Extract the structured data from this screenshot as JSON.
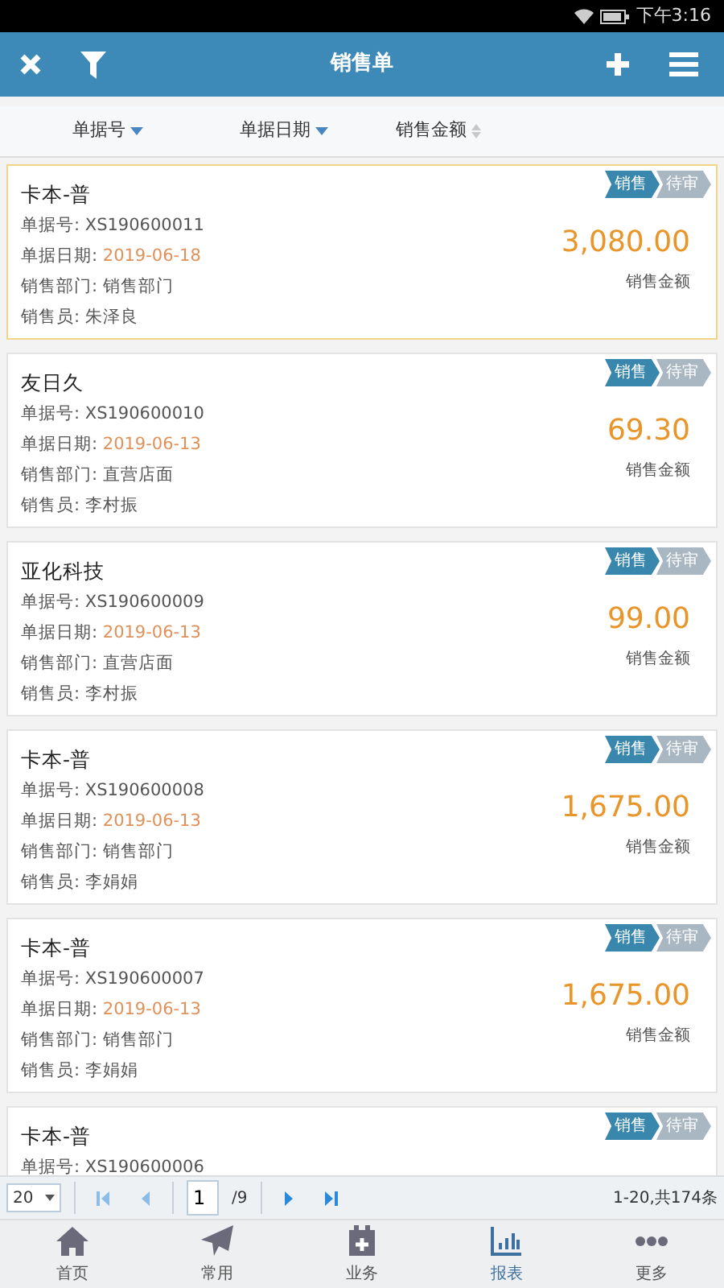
{
  "status_bar": {
    "time": "下午3:16"
  },
  "header": {
    "title": "销售单"
  },
  "sort_bar": [
    {
      "label": "单据号",
      "sorted": true
    },
    {
      "label": "单据日期",
      "sorted": true
    },
    {
      "label": "销售金额",
      "sorted": false
    }
  ],
  "orders": [
    {
      "customer": "卡本-普",
      "selected": true,
      "tags": [
        {
          "label": "销售",
          "color": "#3a87ad"
        },
        {
          "label": "待审",
          "color": "#a9b7c3"
        }
      ],
      "fields": [
        {
          "label": "单据号:",
          "value": "XS190600011",
          "kind": "plain"
        },
        {
          "label": "单据日期:",
          "value": "2019-06-18",
          "kind": "date"
        },
        {
          "label": "销售部门:",
          "value": "销售部门",
          "kind": "plain"
        },
        {
          "label": "销售员:",
          "value": "朱泽良",
          "kind": "plain"
        }
      ],
      "amount": "3,080.00",
      "amount_label": "销售金额"
    },
    {
      "customer": "友日久",
      "selected": false,
      "tags": [
        {
          "label": "销售",
          "color": "#3a87ad"
        },
        {
          "label": "待审",
          "color": "#a9b7c3"
        }
      ],
      "fields": [
        {
          "label": "单据号:",
          "value": "XS190600010",
          "kind": "plain"
        },
        {
          "label": "单据日期:",
          "value": "2019-06-13",
          "kind": "date"
        },
        {
          "label": "销售部门:",
          "value": "直营店面",
          "kind": "plain"
        },
        {
          "label": "销售员:",
          "value": "李村振",
          "kind": "plain"
        }
      ],
      "amount": "69.30",
      "amount_label": "销售金额"
    },
    {
      "customer": "亚化科技",
      "selected": false,
      "tags": [
        {
          "label": "销售",
          "color": "#3a87ad"
        },
        {
          "label": "待审",
          "color": "#a9b7c3"
        }
      ],
      "fields": [
        {
          "label": "单据号:",
          "value": "XS190600009",
          "kind": "plain"
        },
        {
          "label": "单据日期:",
          "value": "2019-06-13",
          "kind": "date"
        },
        {
          "label": "销售部门:",
          "value": "直营店面",
          "kind": "plain"
        },
        {
          "label": "销售员:",
          "value": "李村振",
          "kind": "plain"
        }
      ],
      "amount": "99.00",
      "amount_label": "销售金额"
    },
    {
      "customer": "卡本-普",
      "selected": false,
      "tags": [
        {
          "label": "销售",
          "color": "#3a87ad"
        },
        {
          "label": "待审",
          "color": "#a9b7c3"
        }
      ],
      "fields": [
        {
          "label": "单据号:",
          "value": "XS190600008",
          "kind": "plain"
        },
        {
          "label": "单据日期:",
          "value": "2019-06-13",
          "kind": "date"
        },
        {
          "label": "销售部门:",
          "value": "销售部门",
          "kind": "plain"
        },
        {
          "label": "销售员:",
          "value": "李娟娟",
          "kind": "plain"
        }
      ],
      "amount": "1,675.00",
      "amount_label": "销售金额"
    },
    {
      "customer": "卡本-普",
      "selected": false,
      "tags": [
        {
          "label": "销售",
          "color": "#3a87ad"
        },
        {
          "label": "待审",
          "color": "#a9b7c3"
        }
      ],
      "fields": [
        {
          "label": "单据号:",
          "value": "XS190600007",
          "kind": "plain"
        },
        {
          "label": "单据日期:",
          "value": "2019-06-13",
          "kind": "date"
        },
        {
          "label": "销售部门:",
          "value": "销售部门",
          "kind": "plain"
        },
        {
          "label": "销售员:",
          "value": "李娟娟",
          "kind": "plain"
        }
      ],
      "amount": "1,675.00",
      "amount_label": "销售金额"
    },
    {
      "customer": "卡本-普",
      "selected": false,
      "tags": [
        {
          "label": "销售",
          "color": "#3a87ad"
        },
        {
          "label": "待审",
          "color": "#a9b7c3"
        }
      ],
      "fields": [
        {
          "label": "单据号:",
          "value": "XS190600006",
          "kind": "plain"
        }
      ]
    }
  ],
  "pager": {
    "page_size": "20",
    "page": "1",
    "pages": "/9",
    "summary": "1-20,共174条"
  },
  "tab_bar": [
    {
      "label": "首页",
      "selected": false
    },
    {
      "label": "常用",
      "selected": false
    },
    {
      "label": "业务",
      "selected": false
    },
    {
      "label": "报表",
      "selected": true
    },
    {
      "label": "更多",
      "selected": false
    }
  ]
}
